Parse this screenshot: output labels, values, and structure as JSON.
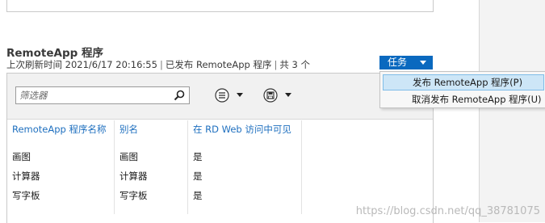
{
  "section": {
    "title": "RemoteApp 程序",
    "last_refresh": "上次刷新时间 2021/6/17 20:16:55",
    "published_info": "已发布 RemoteApp 程序",
    "count_info": "共 3 个"
  },
  "tasks": {
    "label": "任务",
    "menu": [
      "发布 RemoteApp 程序(P)",
      "取消发布 RemoteApp 程序(U)"
    ],
    "highlighted_index": 0
  },
  "filter": {
    "placeholder": "筛选器",
    "value": ""
  },
  "toolbar_icons": [
    "search-icon",
    "list-options-icon",
    "save-icon"
  ],
  "table": {
    "headers": [
      "RemoteApp 程序名称",
      "别名",
      "在 RD Web 访问中可见"
    ],
    "rows": [
      [
        "画图",
        "画图",
        "是"
      ],
      [
        "计算器",
        "计算器",
        "是"
      ],
      [
        "写字板",
        "写字板",
        "是"
      ]
    ]
  },
  "watermark": "https://blog.csdn.net/qq_38781075",
  "colors": {
    "accent": "#0a69bf",
    "header_link": "#1e6fbf",
    "menu_highlight": "#cde6f7"
  }
}
